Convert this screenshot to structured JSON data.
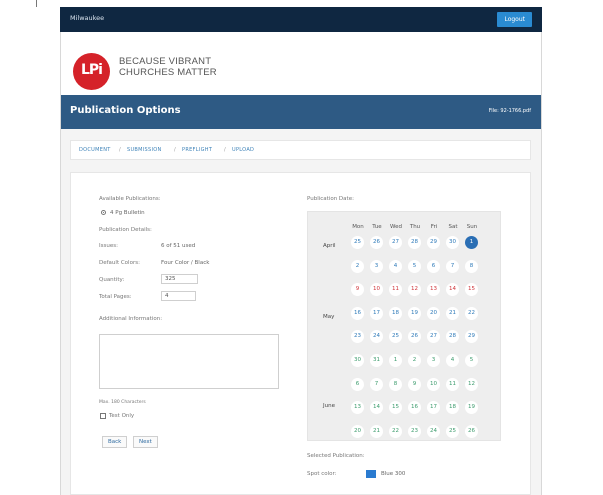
{
  "topbar": {
    "brand": "Milwaukee",
    "logout_label": "Logout"
  },
  "logo": {
    "mark": "LPi",
    "line1": "BECAUSE VIBRANT",
    "line2": "CHURCHES MATTER"
  },
  "hero": {
    "title": "Publication Options",
    "file": "File: 92-1766.pdf"
  },
  "breadcrumb": [
    "DOCUMENT",
    "SUBMISSION",
    "PREFLIGHT",
    "UPLOAD"
  ],
  "form": {
    "available_label": "Available Publications:",
    "publication_option": "4 Pg Bulletin",
    "details_label": "Publication Details:",
    "issues_label": "Issues:",
    "issues_value": "6 of 51 used",
    "default_colors_label": "Default Colors:",
    "default_colors_value": "Four Color / Black",
    "quantity_label": "Quantity:",
    "quantity_value": "325",
    "total_pages_label": "Total Pages:",
    "total_pages_value": "4",
    "additional_label": "Additional Information:",
    "max_chars": "Max. 180 Characters",
    "test_only": "Test Only",
    "back_label": "Back",
    "next_label": "Next"
  },
  "calendar": {
    "label": "Publication Date:",
    "days": [
      "Mon",
      "Tue",
      "Wed",
      "Thu",
      "Fri",
      "Sat",
      "Sun"
    ],
    "months": [
      "April",
      "May",
      "June"
    ],
    "rows": [
      [
        "25",
        "26",
        "27",
        "28",
        "29",
        "30",
        "1"
      ],
      [
        "2",
        "3",
        "4",
        "5",
        "6",
        "7",
        "8"
      ],
      [
        "9",
        "10",
        "11",
        "12",
        "13",
        "14",
        "15"
      ],
      [
        "16",
        "17",
        "18",
        "19",
        "20",
        "21",
        "22"
      ],
      [
        "23",
        "24",
        "25",
        "26",
        "27",
        "28",
        "29"
      ],
      [
        "30",
        "31",
        "1",
        "2",
        "3",
        "4",
        "5"
      ],
      [
        "6",
        "7",
        "8",
        "9",
        "10",
        "11",
        "12"
      ],
      [
        "13",
        "14",
        "15",
        "16",
        "17",
        "18",
        "19"
      ],
      [
        "20",
        "21",
        "22",
        "23",
        "24",
        "25",
        "26"
      ]
    ],
    "selected": "1"
  },
  "selected_publication": {
    "label": "Selected Publication:",
    "spot_label": "Spot color:",
    "spot_value": "Blue 300",
    "spot_color": "#2a7bd0"
  },
  "colors": {
    "topbar": "#0f2741",
    "hero": "#2e5a84",
    "logo_red": "#d52229",
    "link": "#3d82b8"
  }
}
